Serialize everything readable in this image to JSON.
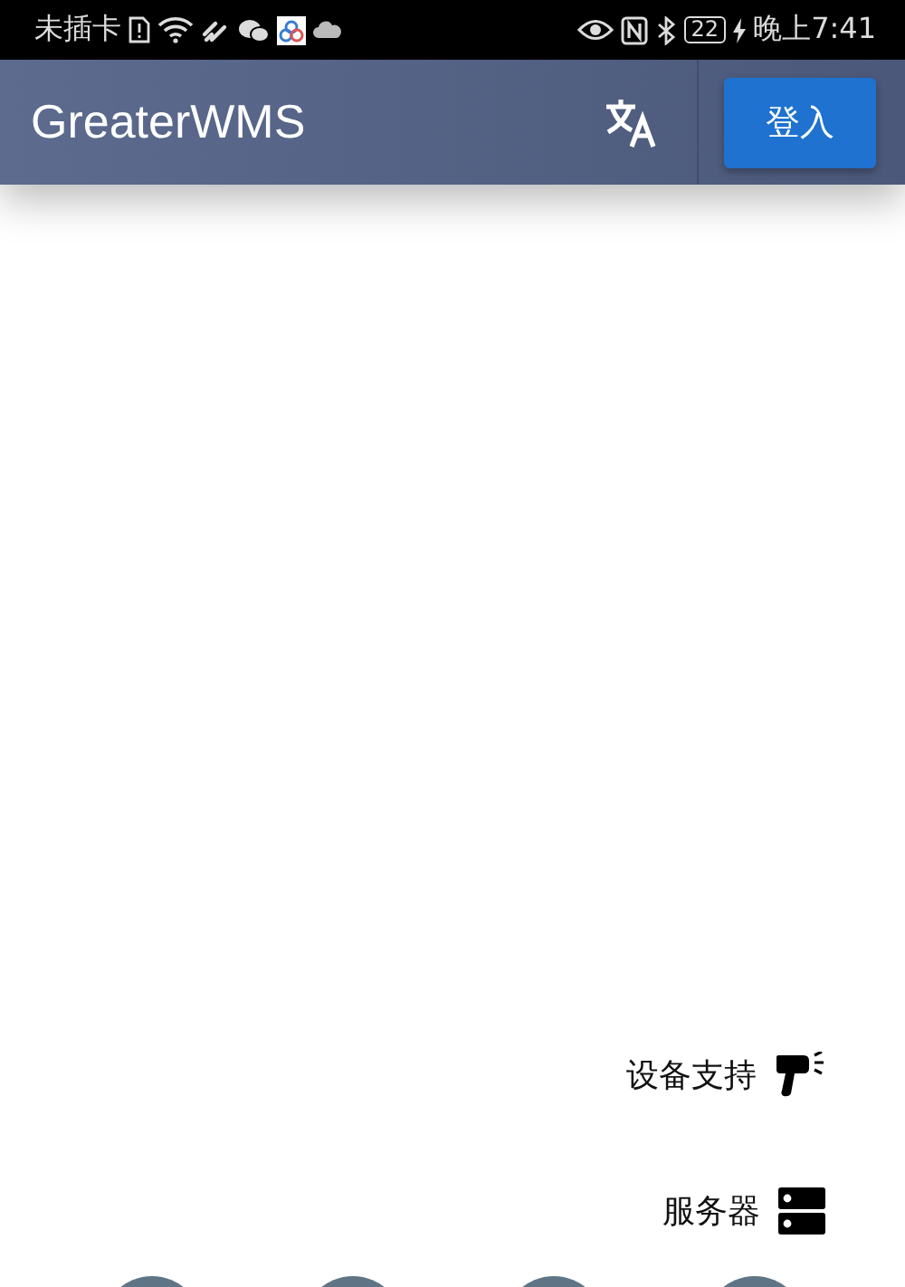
{
  "status_bar": {
    "carrier": "未插卡",
    "battery": "22",
    "time": "晚上7:41"
  },
  "app_bar": {
    "title": "GreaterWMS",
    "login_button": "登入"
  },
  "menu": [
    {
      "label": "设备支持",
      "kind": "scanner"
    },
    {
      "label": "服务器",
      "kind": "server"
    }
  ]
}
